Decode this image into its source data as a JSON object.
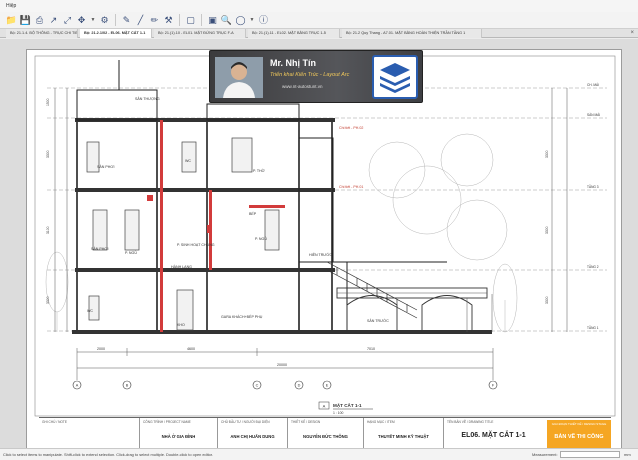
{
  "app": {
    "title": "Hiệp"
  },
  "toolbar": {
    "icons": [
      "folder-open-icon",
      "save-icon",
      "print-icon",
      "export-icon",
      "crop-icon",
      "pan-icon",
      "settings-icon",
      "pen-icon",
      "line-icon",
      "highlight-icon",
      "dropper-icon",
      "measure-icon",
      "stamp-icon",
      "zoom-icon",
      "compass-icon",
      "help-icon"
    ]
  },
  "tabs": [
    {
      "label": "Bộ: 21.1.4. BỘ THÔNG - TRỤC CHI TIẾT (DI 1...",
      "active": false
    },
    {
      "label": "Bộ: 21.2.1/02 - EL06. MẶT CẮT 1-1",
      "active": true
    },
    {
      "label": "Bộ: 21.(1).10 - EL01. MẶT ĐỨNG TRỤC F-A",
      "active": false
    },
    {
      "label": "Bộ: 21.(1).11 - EL02. MẶT BẰNG TRỤC 1-5",
      "active": false
    },
    {
      "label": "Bộ: 21.2 Quy Thang - A7.01. MẶT BẰNG HOÀN THIỆN TRẦN TẦNG 1",
      "active": false
    }
  ],
  "banner": {
    "name": "Mr. Nhị Tín",
    "role": "Triển khai Kiến Trúc - Layout Arc",
    "website": "www.nt-autostunt.vn"
  },
  "drawing": {
    "rooms": [
      "SÂN THƯỢNG",
      "SÂN PHƠI",
      "WC",
      "P. THỜ",
      "SÂN PHƠI",
      "P. NGỦ",
      "P. NGỦ",
      "BẾP",
      "HÀNH LANG",
      "HIÊN TRƯỚC",
      "WC",
      "GARA KHÁCH+BẾP PHỤ",
      "SÂN TRƯỚC",
      "P. SINH HOẠT CHUNG",
      "KHO"
    ],
    "levels": [
      "CH. MÁI",
      "SÀN MÁI",
      "TẦNG 3",
      "TẦNG 2",
      "TẦNG 1",
      "SÂN",
      "CỐT ±0.000"
    ],
    "notes": [
      "Chi tiết - PH.02",
      "Chi tiết - PH.01"
    ],
    "dims_bottom": [
      "2000",
      "4600",
      "7010"
    ],
    "dim_total": "20000",
    "grids": [
      "A",
      "B",
      "C",
      "D",
      "E",
      "F"
    ],
    "dims_left": [
      "1500",
      "3300",
      "3100",
      "3300",
      "1100"
    ],
    "dims_right": [
      "3300",
      "3300",
      "3300",
      "900"
    ],
    "section_label": "MẶT CẮT 1-1",
    "section_scale": "1 : 100",
    "section_letter": "A"
  },
  "titleblock": {
    "cells": [
      {
        "head": "GHI CHÚ / NOTE",
        "value": ""
      },
      {
        "head": "CÔNG TRÌNH / PROJECT NAME",
        "value": "NHÀ Ở GIA ĐÌNH"
      },
      {
        "head": "CHỦ ĐẦU TƯ / NGƯỜI ĐẠI DIỆN",
        "value": "ANH CHỊ HUẤN DUNG"
      },
      {
        "head": "THIẾT KẾ / DESIGN",
        "value": "NGUYỄN ĐỨC THÔNG"
      },
      {
        "head": "HẠNG MỤC / ITEM",
        "value": "THUYẾT MINH KỸ THUẬT"
      },
      {
        "head": "TÊN BẢN VẼ / DRAWING TITLE",
        "value": "EL06. MẶT CẮT 1-1"
      }
    ],
    "stage_head": "GIAI ĐOẠN THIẾT KẾ / DESIGN STAGE",
    "stage": "BẢN VẼ THI CÔNG"
  },
  "statusbar": {
    "message": "Click to select items to manipulate. Shift-click to extend selection. Click-drag to select multiple. Double-click to open editor.",
    "measure_label": "Measurement:",
    "unit": "mm"
  }
}
